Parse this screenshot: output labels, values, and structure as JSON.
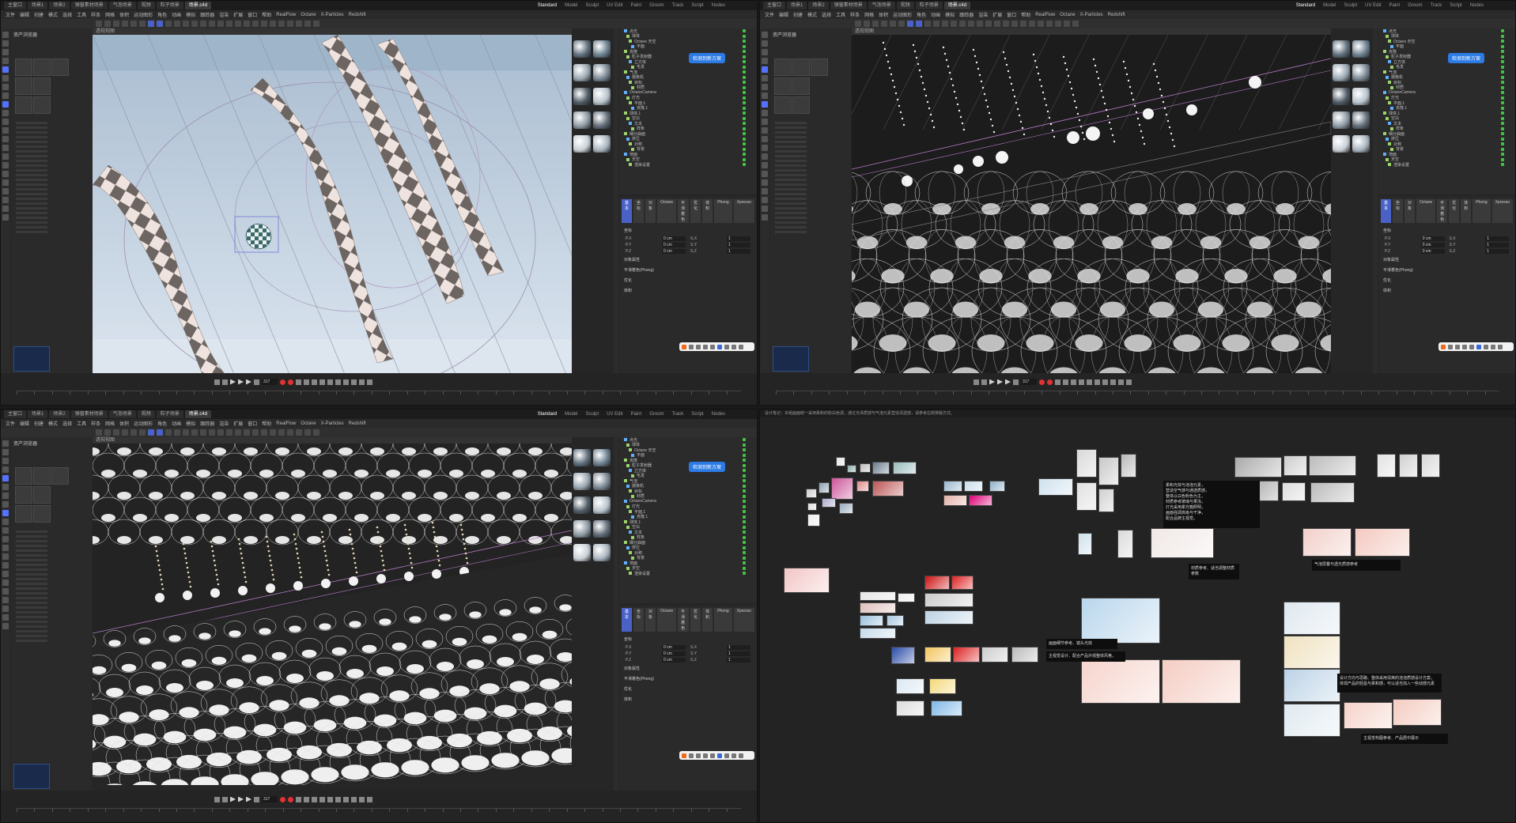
{
  "panes": [
    {
      "tabs": [
        "主窗口",
        "场景1",
        "场景2",
        "弹窗素材场景",
        "气泡场景",
        "视频",
        "粒子场景",
        "场景.c4d"
      ],
      "active_tab": 7,
      "layouts": [
        "Standard",
        "Model",
        "Sculpt",
        "UV Edit",
        "Paint",
        "Groom",
        "Track",
        "Script",
        "Nodes"
      ],
      "active_layout": 0,
      "menus": [
        "文件",
        "编辑",
        "创建",
        "模式",
        "选择",
        "工具",
        "样条",
        "网格",
        "体积",
        "运动图形",
        "角色",
        "动画",
        "模拟",
        "跟踪器",
        "渲染",
        "扩展",
        "窗口",
        "帮助",
        "RealFlow",
        "Octane",
        "X-Particles",
        "Redshift"
      ],
      "viewport_label": "透视视图",
      "frame": "317",
      "badge": "检测到新方案",
      "assets_title": "资产浏览器"
    },
    {
      "tabs": [
        "主窗口",
        "场景1",
        "场景2",
        "弹窗素材场景",
        "气泡场景",
        "视频",
        "粒子场景",
        "场景.c4d"
      ],
      "active_tab": 7,
      "layouts": [
        "Standard",
        "Model",
        "Sculpt",
        "UV Edit",
        "Paint",
        "Groom",
        "Track",
        "Script",
        "Nodes"
      ],
      "active_layout": 0,
      "menus": [
        "文件",
        "编辑",
        "创建",
        "模式",
        "选择",
        "工具",
        "样条",
        "网格",
        "体积",
        "运动图形",
        "角色",
        "动画",
        "模拟",
        "跟踪器",
        "渲染",
        "扩展",
        "窗口",
        "帮助",
        "RealFlow",
        "Octane",
        "X-Particles",
        "Redshift"
      ],
      "viewport_label": "透视视图",
      "frame": "317",
      "badge": "检测到新方案",
      "assets_title": "资产浏览器"
    },
    {
      "tabs": [
        "主窗口",
        "场景1",
        "场景2",
        "弹窗素材场景",
        "气泡场景",
        "视频",
        "粒子场景",
        "场景.c4d"
      ],
      "active_tab": 7,
      "layouts": [
        "Standard",
        "Model",
        "Sculpt",
        "UV Edit",
        "Paint",
        "Groom",
        "Track",
        "Script",
        "Nodes"
      ],
      "active_layout": 0,
      "menus": [
        "文件",
        "编辑",
        "创建",
        "模式",
        "选择",
        "工具",
        "样条",
        "网格",
        "体积",
        "运动图形",
        "角色",
        "动画",
        "模拟",
        "跟踪器",
        "渲染",
        "扩展",
        "窗口",
        "帮助",
        "RealFlow",
        "Octane",
        "X-Particles",
        "Redshift"
      ],
      "viewport_label": "透视视图",
      "frame": "317",
      "badge": "检测到新方案",
      "assets_title": "资产浏览器"
    }
  ],
  "objects": [
    "点光",
    "球体",
    "Octane 天空",
    "平面",
    "克隆",
    "粒子发射器",
    "立方体",
    "毛发",
    "气泡",
    "摄像机",
    "目标",
    "材质",
    "OctaneCamera",
    "灯光",
    "平面.1",
    "克隆.1",
    "球体.1",
    "空白",
    "文本",
    "样条",
    "细分曲面",
    "挤压",
    "对称",
    "背景",
    "地面",
    "天空",
    "渲染设置"
  ],
  "attr": {
    "tabs": [
      "基本",
      "坐标",
      "对象",
      "Octane",
      "平滑着色",
      "优化",
      "体积",
      "Phong",
      "Xpresso"
    ],
    "active": 0,
    "sections": [
      "坐标",
      "对象属性",
      "平滑着色(Phong)",
      "优化",
      "体积"
    ],
    "rows": [
      {
        "label": "P.X",
        "value": "0 cm",
        "label2": "S.X",
        "value2": "1"
      },
      {
        "label": "P.Y",
        "value": "0 cm",
        "label2": "S.Y",
        "value2": "1"
      },
      {
        "label": "P.Z",
        "value": "0 cm",
        "label2": "S.Z",
        "value2": "1"
      }
    ]
  },
  "board": {
    "note": "设计笔记：本组画面统一采用柔和的粉白色调，通过光泽质感与气泡元素营造清透感，请参考右侧排版方式。",
    "texts": [
      "柔和光效与泡泡元素，\n营造空气感与通透质感，\n整体以白色粉色为主，\n材质参考玻璃与果冻，\n灯光采用柔光箱照明，\n画面强调高级与干净，\n配合品牌主视觉。",
      "材质参考、适当调整材质参数",
      "主视觉设计、配合产品外观整体风格，",
      "画面细节参考、镜头光效",
      "设计方向与思路、整体采用清爽的泡泡质感设计方案，\n体现产品的轻盈与柔和感，可以适当加入一些动感元素",
      "气泡层叠与透光质感参考",
      "主视觉构图参考、产品居中展示"
    ]
  },
  "colors": {
    "accent": "#4a62c8",
    "badge": "#2c7be5",
    "record": "#e03232"
  }
}
